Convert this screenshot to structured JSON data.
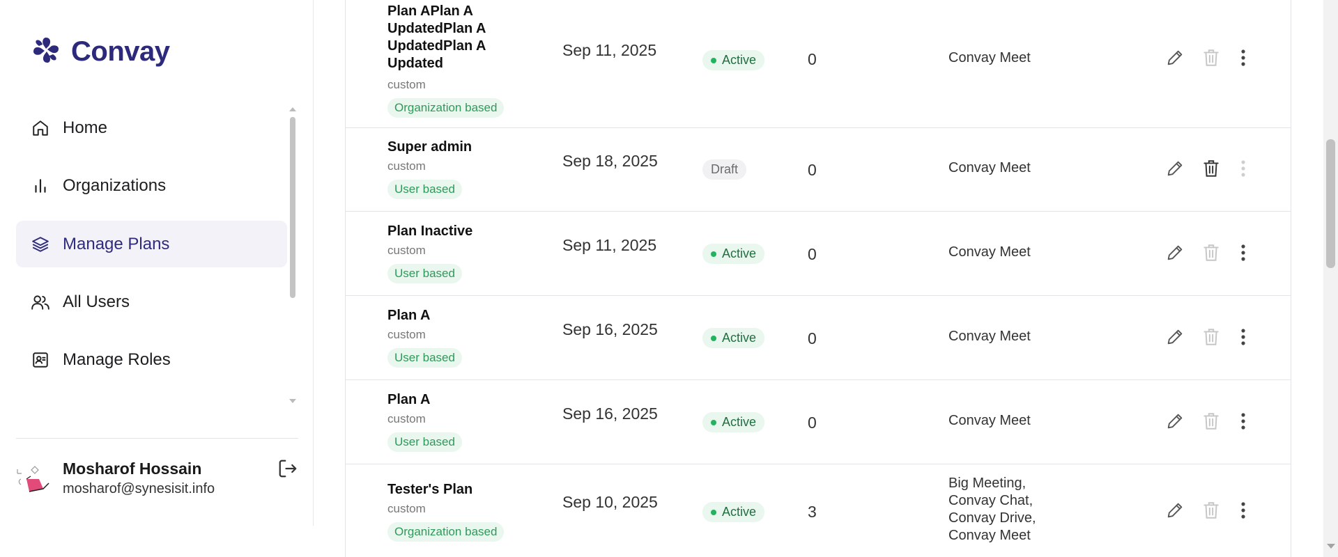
{
  "app": {
    "brand": "Convay"
  },
  "sidebar": {
    "items": [
      {
        "label": "Home",
        "icon": "home-icon"
      },
      {
        "label": "Organizations",
        "icon": "bar-chart-icon"
      },
      {
        "label": "Manage Plans",
        "icon": "layers-icon",
        "active": true
      },
      {
        "label": "All Users",
        "icon": "users-icon"
      },
      {
        "label": "Manage Roles",
        "icon": "id-badge-icon"
      }
    ]
  },
  "user": {
    "name": "Mosharof Hossain",
    "email": "mosharof@synesisit.info"
  },
  "colors": {
    "brand": "#2d2a7b",
    "active_green": "#22b35e",
    "tag_green": "#2e9a5a"
  },
  "plans": [
    {
      "name": "Plan APlan A UpdatedPlan A UpdatedPlan A Updated",
      "type": "custom",
      "tag": "Organization based",
      "date": "Sep 11, 2025",
      "status": "Active",
      "count": "0",
      "products": "Convay Meet"
    },
    {
      "name": "Super admin",
      "type": "custom",
      "tag": "User based",
      "date": "Sep 18, 2025",
      "status": "Draft",
      "count": "0",
      "products": "Convay Meet"
    },
    {
      "name": "Plan Inactive",
      "type": "custom",
      "tag": "User based",
      "date": "Sep 11, 2025",
      "status": "Active",
      "count": "0",
      "products": "Convay Meet"
    },
    {
      "name": "Plan A",
      "type": "custom",
      "tag": "User based",
      "date": "Sep 16, 2025",
      "status": "Active",
      "count": "0",
      "products": "Convay Meet"
    },
    {
      "name": "Plan A",
      "type": "custom",
      "tag": "User based",
      "date": "Sep 16, 2025",
      "status": "Active",
      "count": "0",
      "products": "Convay Meet"
    },
    {
      "name": "Tester's Plan",
      "type": "custom",
      "tag": "Organization based",
      "date": "Sep 10, 2025",
      "status": "Active",
      "count": "3",
      "products": "Big Meeting, Convay Chat, Convay Drive, Convay Meet"
    }
  ]
}
